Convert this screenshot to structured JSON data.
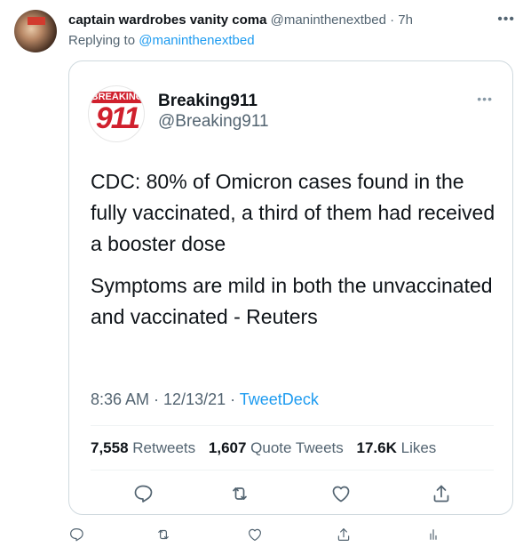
{
  "reply": {
    "display_name": "captain wardrobes vanity coma",
    "handle": "@maninthenextbed",
    "dot": "·",
    "time": "7h",
    "replying_prefix": "Replying to",
    "replying_to": "@maninthenextbed"
  },
  "quote": {
    "avatar_top": "BREAKING",
    "avatar_num": "911",
    "display_name": "Breaking911",
    "handle": "@Breaking911",
    "paragraphs": [
      "CDC: 80% of Omicron cases found in the fully vaccinated, a third of them had received a booster dose",
      "Symptoms are mild in both the unvaccinated and vaccinated - Reuters"
    ],
    "timestamp": "8:36 AM · 12/13/21 · ",
    "source": "TweetDeck",
    "stats": {
      "retweets_count": "7,558",
      "retweets_label": "Retweets",
      "quotes_count": "1,607",
      "quotes_label": "Quote Tweets",
      "likes_count": "17.6K",
      "likes_label": "Likes"
    }
  },
  "colors": {
    "link": "#1d9bf0",
    "secondary_text": "#536471",
    "brand_red": "#d0202d"
  },
  "icons": [
    "more-icon",
    "reply-icon",
    "retweet-icon",
    "like-icon",
    "share-icon",
    "analytics-icon"
  ]
}
